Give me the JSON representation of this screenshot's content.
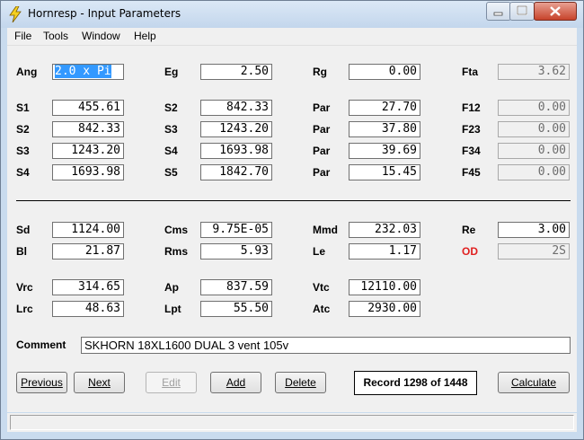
{
  "window": {
    "title": "Hornresp - Input Parameters"
  },
  "menu": [
    "File",
    "Tools",
    "Window",
    "Help"
  ],
  "horn": [
    {
      "label": "Ang",
      "value": "2.0 x Pi"
    },
    {
      "label": "Eg",
      "value": "2.50"
    },
    {
      "label": "Rg",
      "value": "0.00"
    },
    {
      "label": "Fta",
      "value": "3.62"
    },
    {
      "label": "S1",
      "value": "455.61"
    },
    {
      "label": "S2",
      "value": "842.33"
    },
    {
      "label": "Par",
      "value": "27.70"
    },
    {
      "label": "F12",
      "value": "0.00"
    },
    {
      "label": "S2",
      "value": "842.33"
    },
    {
      "label": "S3",
      "value": "1243.20"
    },
    {
      "label": "Par",
      "value": "37.80"
    },
    {
      "label": "F23",
      "value": "0.00"
    },
    {
      "label": "S3",
      "value": "1243.20"
    },
    {
      "label": "S4",
      "value": "1693.98"
    },
    {
      "label": "Par",
      "value": "39.69"
    },
    {
      "label": "F34",
      "value": "0.00"
    },
    {
      "label": "S4",
      "value": "1693.98"
    },
    {
      "label": "S5",
      "value": "1842.70"
    },
    {
      "label": "Par",
      "value": "15.45"
    },
    {
      "label": "F45",
      "value": "0.00"
    }
  ],
  "driver": [
    {
      "label": "Sd",
      "value": "1124.00"
    },
    {
      "label": "Cms",
      "value": "9.75E-05"
    },
    {
      "label": "Mmd",
      "value": "232.03"
    },
    {
      "label": "Re",
      "value": "3.00"
    },
    {
      "label": "Bl",
      "value": "21.87"
    },
    {
      "label": "Rms",
      "value": "5.93"
    },
    {
      "label": "Le",
      "value": "1.17"
    },
    {
      "label": "OD",
      "value": "2S"
    }
  ],
  "chamber": [
    {
      "label": "Vrc",
      "value": "314.65"
    },
    {
      "label": "Ap",
      "value": "837.59"
    },
    {
      "label": "Vtc",
      "value": "12110.00"
    },
    {
      "label": "Lrc",
      "value": "48.63"
    },
    {
      "label": "Lpt",
      "value": "55.50"
    },
    {
      "label": "Atc",
      "value": "2930.00"
    }
  ],
  "comment": {
    "label": "Comment",
    "value": "SKHORN 18XL1600 DUAL 3 vent 105v"
  },
  "buttons": {
    "previous": "Previous",
    "next": "Next",
    "edit": "Edit",
    "add": "Add",
    "delete": "Delete",
    "calculate": "Calculate"
  },
  "record": "Record 1298 of 1448",
  "colors": {
    "od_label": "#e02020",
    "selection": "#3399ff"
  }
}
